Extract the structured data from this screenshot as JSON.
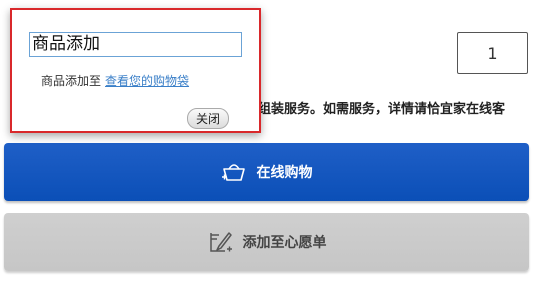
{
  "quantity": {
    "value": "1"
  },
  "notice": {
    "partial_text": "有偿组装服务。如需服务，详情请恰宜家在线客"
  },
  "buttons": {
    "buy_label": "在线购物",
    "wishlist_label": "添加至心愿单"
  },
  "popup": {
    "title": "商品添加",
    "message": "商品添加至",
    "link": "查看您的购物袋",
    "close_label": "关闭"
  },
  "colors": {
    "buy_blue": "#0b4fb7",
    "wishlist_gray": "#c8c8c8",
    "popup_border_red": "#d9282b",
    "link_blue": "#3a7fc8"
  },
  "icons": {
    "buy": "shopping-basket-icon",
    "wishlist": "pen-list-icon"
  }
}
